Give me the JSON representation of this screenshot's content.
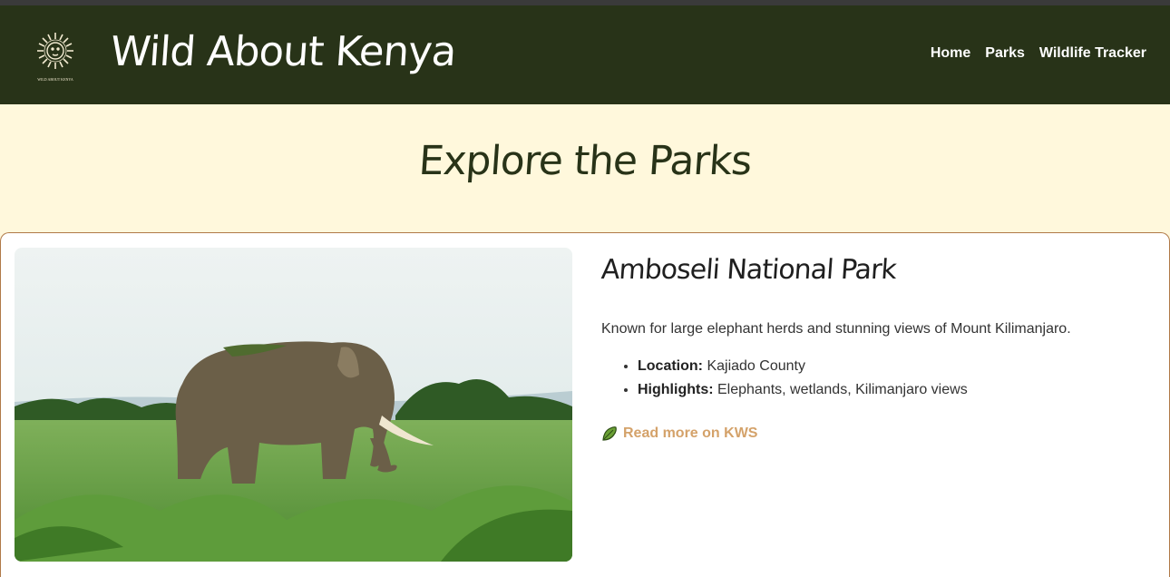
{
  "header": {
    "logo_text": "WILD ABOUT KENYA",
    "brand": "Wild About Kenya",
    "nav": [
      {
        "label": "Home"
      },
      {
        "label": "Parks"
      },
      {
        "label": "Wildlife Tracker"
      }
    ]
  },
  "hero": {
    "title": "Explore the Parks"
  },
  "park": {
    "name": "Amboseli National Park",
    "image_icon": "elephant-photo",
    "description": "Known for large elephant herds and stunning views of Mount Kilimanjaro.",
    "facts": [
      {
        "label": "Location:",
        "value": "Kajiado County"
      },
      {
        "label": "Highlights:",
        "value": "Elephants, wetlands, Kilimanjaro views"
      }
    ],
    "link_icon": "leaf-icon",
    "link_label": "Read more on KWS"
  },
  "colors": {
    "header_bg": "#283318",
    "page_bg": "#fff8dc",
    "link": "#d4a26a",
    "card_border": "#b07a48"
  }
}
